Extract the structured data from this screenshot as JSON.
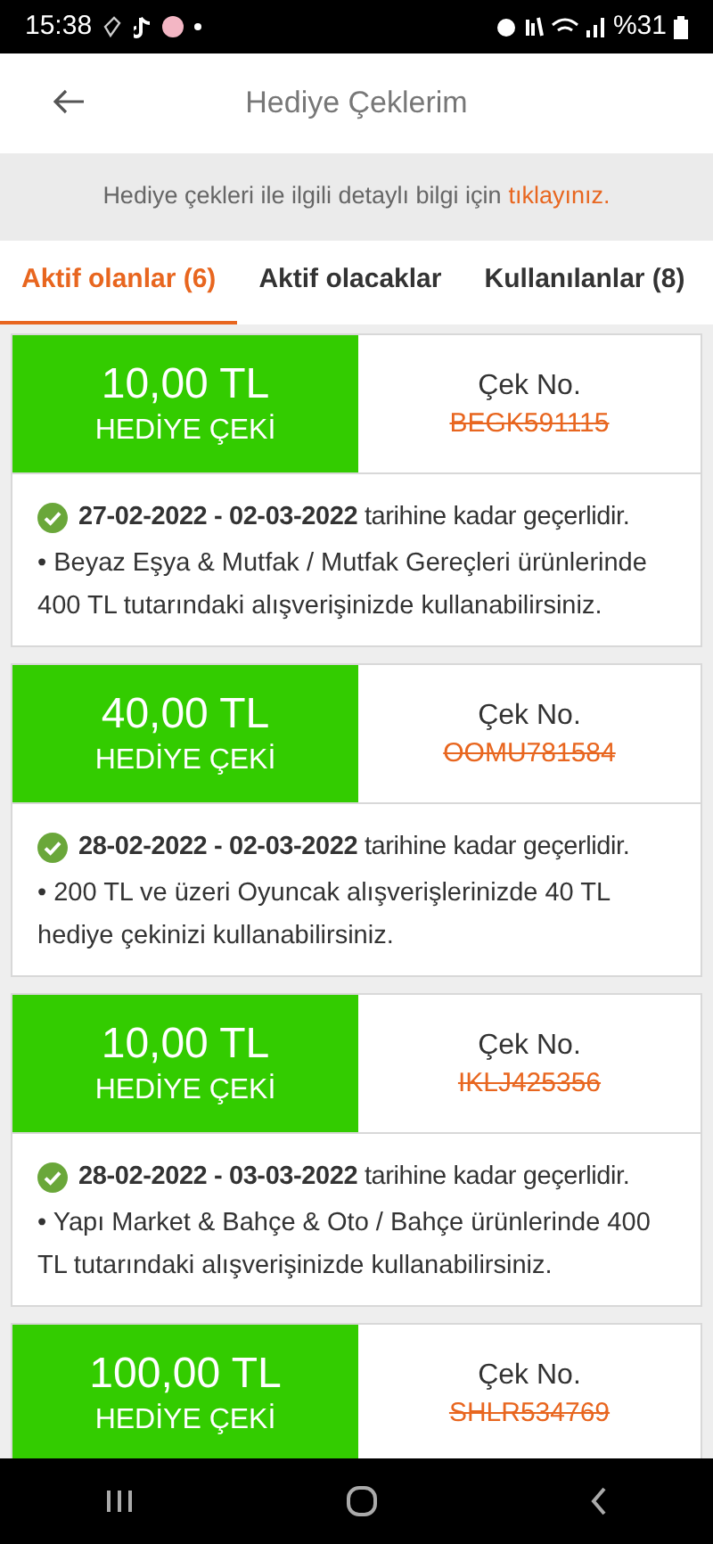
{
  "status_bar": {
    "time": "15:38",
    "battery": "%31"
  },
  "header": {
    "title": "Hediye Çeklerim"
  },
  "info_banner": {
    "text": "Hediye çekleri ile ilgili detaylı bilgi için",
    "link": "tıklayınız."
  },
  "tabs": [
    {
      "label": "Aktif olanlar (6)",
      "selected": true
    },
    {
      "label": "Aktif olacaklar",
      "selected": false
    },
    {
      "label": "Kullanılanlar (8)",
      "selected": false
    }
  ],
  "coupons": [
    {
      "amount": "10,00 TL",
      "type": "HEDİYE ÇEKİ",
      "code_label": "Çek No.",
      "code": "BEGK591115",
      "validity": "**27-02-2022 - 02-03-2022** tarihine kadar geçerlidir.",
      "condition": "• Beyaz Eşya & Mutfak / Mutfak Gereçleri ürünlerinde 400 TL tutarındaki alışverişinizde kullanabilirsiniz."
    },
    {
      "amount": "40,00 TL",
      "type": "HEDİYE ÇEKİ",
      "code_label": "Çek No.",
      "code": "OOMU781584",
      "validity": "**28-02-2022 - 02-03-2022** tarihine kadar geçerlidir.",
      "condition": "• 200 TL ve üzeri Oyuncak alışverişlerinizde 40 TL hediye çekinizi kullanabilirsiniz."
    },
    {
      "amount": "10,00 TL",
      "type": "HEDİYE ÇEKİ",
      "code_label": "Çek No.",
      "code": "IKLJ425356",
      "validity": "**28-02-2022 - 03-03-2022** tarihine kadar geçerlidir.",
      "condition": "• Yapı Market & Bahçe & Oto / Bahçe ürünlerinde 400 TL tutarındaki alışverişinizde kullanabilirsiniz."
    },
    {
      "amount": "100,00 TL",
      "type": "HEDİYE ÇEKİ",
      "code_label": "Çek No.",
      "code": "SHLR534769"
    }
  ]
}
